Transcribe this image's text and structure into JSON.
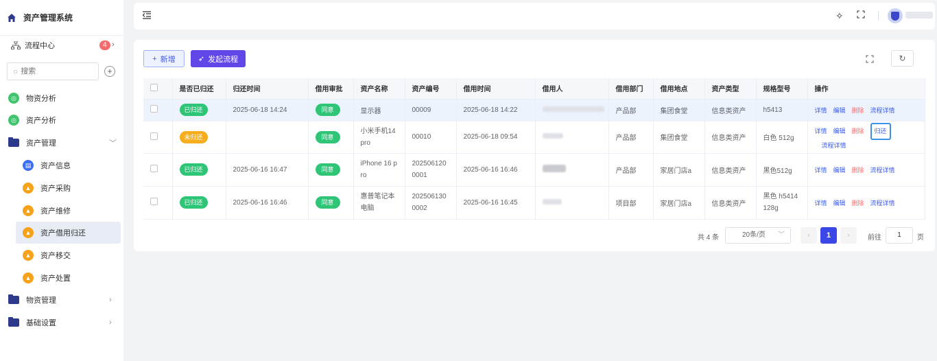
{
  "app": {
    "title": "资产管理系统"
  },
  "sidebar": {
    "flow_center": {
      "label": "流程中心",
      "badge": "4"
    },
    "search_placeholder": "搜索",
    "items": [
      {
        "label": "物资分析",
        "icon": "chart-icon",
        "color": "#3ec46d"
      },
      {
        "label": "资产分析",
        "icon": "chart-icon",
        "color": "#3ec46d"
      },
      {
        "label": "资产管理",
        "icon": "folder-icon",
        "expanded": true
      },
      {
        "label": "资产信息",
        "icon": "document-icon",
        "color": "#3c6ef6"
      },
      {
        "label": "资产采购",
        "icon": "boxes-icon",
        "color": "#f7a21b"
      },
      {
        "label": "资产维修",
        "icon": "boxes-icon",
        "color": "#f7a21b"
      },
      {
        "label": "资产借用归还",
        "icon": "boxes-icon",
        "color": "#f7a21b",
        "active": true
      },
      {
        "label": "资产移交",
        "icon": "boxes-icon",
        "color": "#f7a21b"
      },
      {
        "label": "资产处置",
        "icon": "boxes-icon",
        "color": "#f7a21b"
      },
      {
        "label": "物资管理",
        "icon": "folder-icon"
      },
      {
        "label": "基础设置",
        "icon": "folder-icon"
      }
    ]
  },
  "toolbar": {
    "add_label": "新增",
    "flow_label": "发起流程"
  },
  "table": {
    "headers": [
      "是否已归还",
      "归还时间",
      "借用审批",
      "资产名称",
      "资产编号",
      "借用时间",
      "借用人",
      "借用部门",
      "借用地点",
      "资产类型",
      "规格型号",
      "操作"
    ],
    "ops": {
      "detail": "详情",
      "edit": "编辑",
      "delete": "删除",
      "flow_detail": "流程详情",
      "return": "归还"
    },
    "rows": [
      {
        "returned": "已归还",
        "return_time": "2025-06-18 14:24",
        "approval": "同意",
        "asset_name": "显示器",
        "asset_no": "00009",
        "borrow_time": "2025-06-18 14:22",
        "dept": "产品部",
        "place": "集团食堂",
        "type": "信息类资产",
        "spec": "h5413"
      },
      {
        "returned": "未归还",
        "return_time": "",
        "approval": "同意",
        "asset_name": "小米手机14pro",
        "asset_no": "00010",
        "borrow_time": "2025-06-18 09:54",
        "dept": "产品部",
        "place": "集团食堂",
        "type": "信息类资产",
        "spec": "白色 512g"
      },
      {
        "returned": "已归还",
        "return_time": "2025-06-16 16:47",
        "approval": "同意",
        "asset_name": "iPhone 16 pro",
        "asset_no": "2025061200001",
        "borrow_time": "2025-06-16 16:46",
        "dept": "产品部",
        "place": "家居门店a",
        "type": "信息类资产",
        "spec": "黑色512g"
      },
      {
        "returned": "已归还",
        "return_time": "2025-06-16 16:46",
        "approval": "同意",
        "asset_name": "惠普笔记本电脑",
        "asset_no": "2025061300002",
        "borrow_time": "2025-06-16 16:45",
        "dept": "项目部",
        "place": "家居门店a",
        "type": "信息类资产",
        "spec": "黑色 h5414 128g"
      }
    ]
  },
  "pagination": {
    "total": "共 4 条",
    "page_size": "20条/页",
    "current": "1",
    "goto_label": "前往",
    "goto_value": "1",
    "page_unit": "页"
  },
  "colors": {
    "primary": "#3c47e8",
    "purple": "#6247e8",
    "success": "#2ec577",
    "warning": "#f6ad1e",
    "danger": "#f56c6c"
  }
}
